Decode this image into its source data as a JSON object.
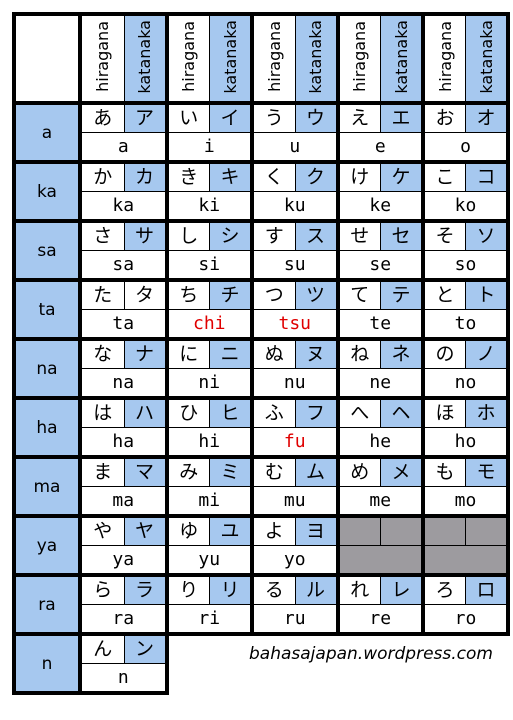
{
  "header": {
    "columns": [
      {
        "hiragana_label": "hiragana",
        "katakana_label": "katanaka"
      },
      {
        "hiragana_label": "hiragana",
        "katakana_label": "katanaka"
      },
      {
        "hiragana_label": "hiragana",
        "katakana_label": "katanaka"
      },
      {
        "hiragana_label": "hiragana",
        "katakana_label": "katanaka"
      },
      {
        "hiragana_label": "hiragana",
        "katakana_label": "katanaka"
      }
    ]
  },
  "colors": {
    "katakana_bg": "#a6c8ef",
    "row_header_bg": "#a6c8ef",
    "empty_cell_bg": "#9d9b9f",
    "highlight_text": "#e00000"
  },
  "rows": [
    {
      "label": "a",
      "cells": [
        {
          "hiragana": "あ",
          "katakana": "ア",
          "romaji": "a"
        },
        {
          "hiragana": "い",
          "katakana": "イ",
          "romaji": "i"
        },
        {
          "hiragana": "う",
          "katakana": "ウ",
          "romaji": "u"
        },
        {
          "hiragana": "え",
          "katakana": "エ",
          "romaji": "e"
        },
        {
          "hiragana": "お",
          "katakana": "オ",
          "romaji": "o"
        }
      ]
    },
    {
      "label": "ka",
      "cells": [
        {
          "hiragana": "か",
          "katakana": "カ",
          "romaji": "ka"
        },
        {
          "hiragana": "き",
          "katakana": "キ",
          "romaji": "ki"
        },
        {
          "hiragana": "く",
          "katakana": "ク",
          "romaji": "ku"
        },
        {
          "hiragana": "け",
          "katakana": "ケ",
          "romaji": "ke"
        },
        {
          "hiragana": "こ",
          "katakana": "コ",
          "romaji": "ko"
        }
      ]
    },
    {
      "label": "sa",
      "cells": [
        {
          "hiragana": "さ",
          "katakana": "サ",
          "romaji": "sa"
        },
        {
          "hiragana": "し",
          "katakana": "シ",
          "romaji": "si"
        },
        {
          "hiragana": "す",
          "katakana": "ス",
          "romaji": "su"
        },
        {
          "hiragana": "せ",
          "katakana": "セ",
          "romaji": "se"
        },
        {
          "hiragana": "そ",
          "katakana": "ソ",
          "romaji": "so"
        }
      ]
    },
    {
      "label": "ta",
      "cells": [
        {
          "hiragana": "た",
          "katakana": "タ",
          "romaji": "ta",
          "katakana_plain": true
        },
        {
          "hiragana": "ち",
          "katakana": "チ",
          "romaji": "chi",
          "highlight": true
        },
        {
          "hiragana": "つ",
          "katakana": "ツ",
          "romaji": "tsu",
          "highlight": true
        },
        {
          "hiragana": "て",
          "katakana": "テ",
          "romaji": "te"
        },
        {
          "hiragana": "と",
          "katakana": "ト",
          "romaji": "to"
        }
      ]
    },
    {
      "label": "na",
      "cells": [
        {
          "hiragana": "な",
          "katakana": "ナ",
          "romaji": "na"
        },
        {
          "hiragana": "に",
          "katakana": "ニ",
          "romaji": "ni"
        },
        {
          "hiragana": "ぬ",
          "katakana": "ヌ",
          "romaji": "nu"
        },
        {
          "hiragana": "ね",
          "katakana": "ネ",
          "romaji": "ne"
        },
        {
          "hiragana": "の",
          "katakana": "ノ",
          "romaji": "no"
        }
      ]
    },
    {
      "label": "ha",
      "cells": [
        {
          "hiragana": "は",
          "katakana": "ハ",
          "romaji": "ha"
        },
        {
          "hiragana": "ひ",
          "katakana": "ヒ",
          "romaji": "hi"
        },
        {
          "hiragana": "ふ",
          "katakana": "フ",
          "romaji": "fu",
          "highlight": true
        },
        {
          "hiragana": "へ",
          "katakana": "ヘ",
          "romaji": "he"
        },
        {
          "hiragana": "ほ",
          "katakana": "ホ",
          "romaji": "ho"
        }
      ]
    },
    {
      "label": "ma",
      "cells": [
        {
          "hiragana": "ま",
          "katakana": "マ",
          "romaji": "ma"
        },
        {
          "hiragana": "み",
          "katakana": "ミ",
          "romaji": "mi"
        },
        {
          "hiragana": "む",
          "katakana": "ム",
          "romaji": "mu"
        },
        {
          "hiragana": "め",
          "katakana": "メ",
          "romaji": "me"
        },
        {
          "hiragana": "も",
          "katakana": "モ",
          "romaji": "mo"
        }
      ]
    },
    {
      "label": "ya",
      "cells": [
        {
          "hiragana": "や",
          "katakana": "ヤ",
          "romaji": "ya"
        },
        {
          "hiragana": "ゆ",
          "katakana": "ユ",
          "romaji": "yu"
        },
        {
          "hiragana": "よ",
          "katakana": "ヨ",
          "romaji": "yo"
        },
        {
          "empty": true
        },
        {
          "empty": true
        }
      ]
    },
    {
      "label": "ra",
      "cells": [
        {
          "hiragana": "ら",
          "katakana": "ラ",
          "romaji": "ra"
        },
        {
          "hiragana": "り",
          "katakana": "リ",
          "romaji": "ri"
        },
        {
          "hiragana": "る",
          "katakana": "ル",
          "romaji": "ru"
        },
        {
          "hiragana": "れ",
          "katakana": "レ",
          "romaji": "re"
        },
        {
          "hiragana": "ろ",
          "katakana": "ロ",
          "romaji": "ro"
        }
      ]
    },
    {
      "label": "n",
      "cells": [
        {
          "hiragana": "ん",
          "katakana": "ン",
          "romaji": "n"
        }
      ]
    }
  ],
  "credit": "bahasajapan.wordpress.com"
}
